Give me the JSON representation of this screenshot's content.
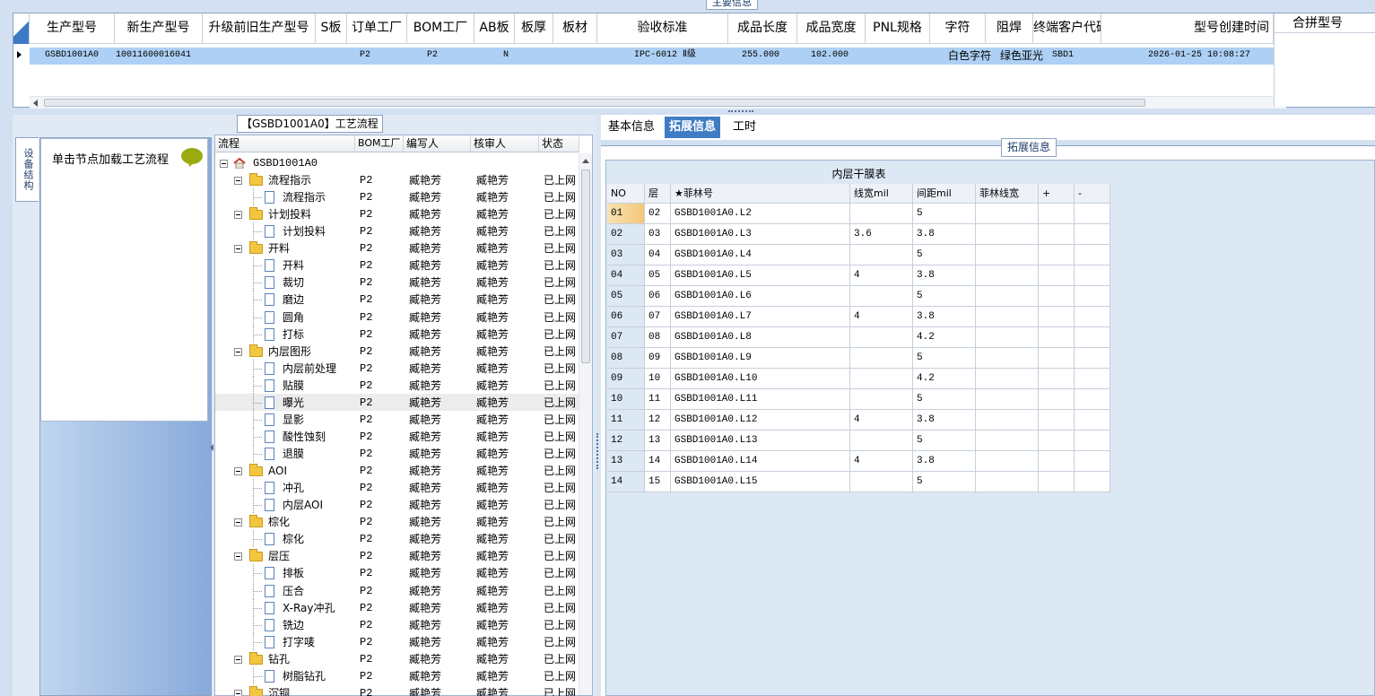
{
  "main": {
    "title": "主要信息",
    "columns": [
      "生产型号",
      "新生产型号",
      "升级前旧生产型号",
      "S板",
      "订单工厂",
      "BOM工厂",
      "AB板",
      "板厚",
      "板材",
      "验收标准",
      "成品长度",
      "成品宽度",
      "PNL规格",
      "字符",
      "阻焊",
      "终端客户代码",
      "型号创建时间"
    ],
    "merge_header": "合拼型号",
    "row": {
      "prod_no": "GSBD1001A0",
      "new_prod_no": "10011600016041",
      "order_factory": "P2",
      "bom_factory": "P2",
      "ab": "N",
      "standard": "IPC-6012 Ⅱ级",
      "length": "255.000",
      "width": "102.000",
      "char": "白色字符",
      "mask": "绿色亚光",
      "customer": "SBD1",
      "created": "2026-01-25 10:08:27"
    }
  },
  "flow": {
    "title": "【GSBD1001A0】工艺流程",
    "side_tab": "设备结构",
    "node_hint": "单击节点加载工艺流程",
    "columns": [
      "流程",
      "BOM工厂",
      "编写人",
      "核审人",
      "状态"
    ],
    "root": "GSBD1001A0",
    "rows": [
      {
        "name": "流程指示",
        "kind": "folder",
        "factory": "P2",
        "writer": "臧艳芳",
        "reviewer": "臧艳芳",
        "status": "已上网"
      },
      {
        "name": "流程指示",
        "kind": "doc",
        "factory": "P2",
        "writer": "臧艳芳",
        "reviewer": "臧艳芳",
        "status": "已上网"
      },
      {
        "name": "计划投料",
        "kind": "folder",
        "factory": "P2",
        "writer": "臧艳芳",
        "reviewer": "臧艳芳",
        "status": "已上网"
      },
      {
        "name": "计划投料",
        "kind": "doc",
        "factory": "P2",
        "writer": "臧艳芳",
        "reviewer": "臧艳芳",
        "status": "已上网"
      },
      {
        "name": "开料",
        "kind": "folder",
        "factory": "P2",
        "writer": "臧艳芳",
        "reviewer": "臧艳芳",
        "status": "已上网"
      },
      {
        "name": "开料",
        "kind": "doc",
        "factory": "P2",
        "writer": "臧艳芳",
        "reviewer": "臧艳芳",
        "status": "已上网"
      },
      {
        "name": "裁切",
        "kind": "doc",
        "factory": "P2",
        "writer": "臧艳芳",
        "reviewer": "臧艳芳",
        "status": "已上网"
      },
      {
        "name": "磨边",
        "kind": "doc",
        "factory": "P2",
        "writer": "臧艳芳",
        "reviewer": "臧艳芳",
        "status": "已上网"
      },
      {
        "name": "圆角",
        "kind": "doc",
        "factory": "P2",
        "writer": "臧艳芳",
        "reviewer": "臧艳芳",
        "status": "已上网"
      },
      {
        "name": "打标",
        "kind": "doc",
        "factory": "P2",
        "writer": "臧艳芳",
        "reviewer": "臧艳芳",
        "status": "已上网"
      },
      {
        "name": "内层图形",
        "kind": "folder",
        "factory": "P2",
        "writer": "臧艳芳",
        "reviewer": "臧艳芳",
        "status": "已上网"
      },
      {
        "name": "内层前处理",
        "kind": "doc",
        "factory": "P2",
        "writer": "臧艳芳",
        "reviewer": "臧艳芳",
        "status": "已上网"
      },
      {
        "name": "贴膜",
        "kind": "doc",
        "factory": "P2",
        "writer": "臧艳芳",
        "reviewer": "臧艳芳",
        "status": "已上网"
      },
      {
        "name": "曝光",
        "kind": "doc",
        "factory": "P2",
        "writer": "臧艳芳",
        "reviewer": "臧艳芳",
        "status": "已上网",
        "selected": true
      },
      {
        "name": "显影",
        "kind": "doc",
        "factory": "P2",
        "writer": "臧艳芳",
        "reviewer": "臧艳芳",
        "status": "已上网"
      },
      {
        "name": "酸性蚀刻",
        "kind": "doc",
        "factory": "P2",
        "writer": "臧艳芳",
        "reviewer": "臧艳芳",
        "status": "已上网"
      },
      {
        "name": "退膜",
        "kind": "doc",
        "factory": "P2",
        "writer": "臧艳芳",
        "reviewer": "臧艳芳",
        "status": "已上网"
      },
      {
        "name": "AOI",
        "kind": "folder",
        "factory": "P2",
        "writer": "臧艳芳",
        "reviewer": "臧艳芳",
        "status": "已上网"
      },
      {
        "name": "冲孔",
        "kind": "doc",
        "factory": "P2",
        "writer": "臧艳芳",
        "reviewer": "臧艳芳",
        "status": "已上网"
      },
      {
        "name": "内层AOI",
        "kind": "doc",
        "factory": "P2",
        "writer": "臧艳芳",
        "reviewer": "臧艳芳",
        "status": "已上网"
      },
      {
        "name": "棕化",
        "kind": "folder",
        "factory": "P2",
        "writer": "臧艳芳",
        "reviewer": "臧艳芳",
        "status": "已上网"
      },
      {
        "name": "棕化",
        "kind": "doc",
        "factory": "P2",
        "writer": "臧艳芳",
        "reviewer": "臧艳芳",
        "status": "已上网"
      },
      {
        "name": "层压",
        "kind": "folder",
        "factory": "P2",
        "writer": "臧艳芳",
        "reviewer": "臧艳芳",
        "status": "已上网"
      },
      {
        "name": "排板",
        "kind": "doc",
        "factory": "P2",
        "writer": "臧艳芳",
        "reviewer": "臧艳芳",
        "status": "已上网"
      },
      {
        "name": "压合",
        "kind": "doc",
        "factory": "P2",
        "writer": "臧艳芳",
        "reviewer": "臧艳芳",
        "status": "已上网"
      },
      {
        "name": "X-Ray冲孔",
        "kind": "doc",
        "factory": "P2",
        "writer": "臧艳芳",
        "reviewer": "臧艳芳",
        "status": "已上网"
      },
      {
        "name": "铣边",
        "kind": "doc",
        "factory": "P2",
        "writer": "臧艳芳",
        "reviewer": "臧艳芳",
        "status": "已上网"
      },
      {
        "name": "打字唛",
        "kind": "doc",
        "factory": "P2",
        "writer": "臧艳芳",
        "reviewer": "臧艳芳",
        "status": "已上网"
      },
      {
        "name": "钻孔",
        "kind": "folder",
        "factory": "P2",
        "writer": "臧艳芳",
        "reviewer": "臧艳芳",
        "status": "已上网"
      },
      {
        "name": "树脂钻孔",
        "kind": "doc",
        "factory": "P2",
        "writer": "臧艳芳",
        "reviewer": "臧艳芳",
        "status": "已上网"
      },
      {
        "name": "沉铜",
        "kind": "folder",
        "factory": "P2",
        "writer": "臧艳芳",
        "reviewer": "臧艳芳",
        "status": "已上网"
      }
    ]
  },
  "right": {
    "tabs": [
      "基本信息",
      "拓展信息",
      "工时"
    ],
    "active_tab": 1,
    "section_title": "拓展信息",
    "grid_title": "内层干膜表",
    "columns": [
      "NO",
      "层",
      "★菲林号",
      "线宽mil",
      "间距mil",
      "菲林线宽",
      "+",
      "-"
    ],
    "rows": [
      {
        "no": "01",
        "layer": "02",
        "film": "GSBD1001A0.L2",
        "lw": "",
        "sp": "5"
      },
      {
        "no": "02",
        "layer": "03",
        "film": "GSBD1001A0.L3",
        "lw": "3.6",
        "sp": "3.8"
      },
      {
        "no": "03",
        "layer": "04",
        "film": "GSBD1001A0.L4",
        "lw": "",
        "sp": "5"
      },
      {
        "no": "04",
        "layer": "05",
        "film": "GSBD1001A0.L5",
        "lw": "4",
        "sp": "3.8"
      },
      {
        "no": "05",
        "layer": "06",
        "film": "GSBD1001A0.L6",
        "lw": "",
        "sp": "5"
      },
      {
        "no": "06",
        "layer": "07",
        "film": "GSBD1001A0.L7",
        "lw": "4",
        "sp": "3.8"
      },
      {
        "no": "07",
        "layer": "08",
        "film": "GSBD1001A0.L8",
        "lw": "",
        "sp": "4.2"
      },
      {
        "no": "08",
        "layer": "09",
        "film": "GSBD1001A0.L9",
        "lw": "",
        "sp": "5"
      },
      {
        "no": "09",
        "layer": "10",
        "film": "GSBD1001A0.L10",
        "lw": "",
        "sp": "4.2"
      },
      {
        "no": "10",
        "layer": "11",
        "film": "GSBD1001A0.L11",
        "lw": "",
        "sp": "5"
      },
      {
        "no": "11",
        "layer": "12",
        "film": "GSBD1001A0.L12",
        "lw": "4",
        "sp": "3.8"
      },
      {
        "no": "12",
        "layer": "13",
        "film": "GSBD1001A0.L13",
        "lw": "",
        "sp": "5"
      },
      {
        "no": "13",
        "layer": "14",
        "film": "GSBD1001A0.L14",
        "lw": "4",
        "sp": "3.8"
      },
      {
        "no": "14",
        "layer": "15",
        "film": "GSBD1001A0.L15",
        "lw": "",
        "sp": "5"
      }
    ]
  },
  "icons": {
    "home": "home-icon",
    "folder": "folder-icon",
    "doc": "document-icon",
    "bubble": "speech-bubble-icon"
  },
  "colors": {
    "selected_row": "#aed0f4",
    "active_tab": "#3e7cc4",
    "folder": "#f2c640",
    "bubble": "#9aaa10"
  }
}
